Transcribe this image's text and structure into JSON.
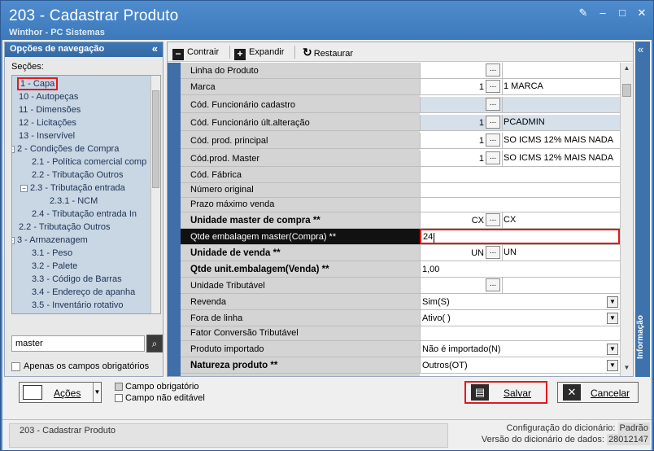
{
  "window": {
    "title": "203 - Cadastrar  Produto",
    "subtitle": "Winthor - PC Sistemas",
    "controls": [
      "✎",
      "–",
      "□",
      "✕"
    ]
  },
  "nav": {
    "header": "Opções de navegação",
    "collapse": "«",
    "sections_label": "Seções:",
    "items": [
      {
        "label": "1 - Capa",
        "level": 0,
        "toggle": ""
      },
      {
        "label": "10 - Autopeças",
        "level": 0,
        "toggle": ""
      },
      {
        "label": "11 - Dimensões",
        "level": 0,
        "toggle": ""
      },
      {
        "label": "12 - Licitações",
        "level": 0,
        "toggle": ""
      },
      {
        "label": "13 - Inservível",
        "level": 0,
        "toggle": ""
      },
      {
        "label": "2 - Condições de Compra",
        "level": 0,
        "toggle": "−"
      },
      {
        "label": "2.1 - Política comercial comp",
        "level": 1,
        "toggle": ""
      },
      {
        "label": "2.2 - Tributação Outros",
        "level": 1,
        "toggle": ""
      },
      {
        "label": "2.3 - Tributação entrada",
        "level": 1,
        "toggle": "−"
      },
      {
        "label": "2.3.1 - NCM",
        "level": 2,
        "toggle": ""
      },
      {
        "label": "2.4 - Tributação entrada In",
        "level": 1,
        "toggle": ""
      },
      {
        "label": "2.2 - Tributação Outros",
        "level": 0,
        "toggle": ""
      },
      {
        "label": "3 - Armazenagem",
        "level": 0,
        "toggle": "−"
      },
      {
        "label": "3.1 - Peso",
        "level": 1,
        "toggle": ""
      },
      {
        "label": "3.2 - Palete",
        "level": 1,
        "toggle": ""
      },
      {
        "label": "3.3 - Código de Barras",
        "level": 1,
        "toggle": ""
      },
      {
        "label": "3.4 - Endereço de apanha",
        "level": 1,
        "toggle": ""
      },
      {
        "label": "3.5 - Inventário rotativo",
        "level": 1,
        "toggle": ""
      }
    ],
    "search_value": "master",
    "only_required_label": "Apenas os campos obrigatórios"
  },
  "toolbar": {
    "contrair": "Contrair",
    "expandir": "Expandir",
    "restaurar": "Restaurar"
  },
  "fields": [
    {
      "label": "Linha do Produto",
      "bold": false,
      "type": "lookup",
      "code": "",
      "desc": "",
      "shade": false
    },
    {
      "label": "Marca",
      "bold": false,
      "type": "lookup",
      "code": "1",
      "desc": "1 MARCA",
      "shade": false
    },
    {
      "label": "Cód. Funcionário cadastro",
      "bold": false,
      "type": "lookup",
      "code": "",
      "desc": "",
      "shade": true
    },
    {
      "label": "Cód. Funcionário últ.alteração",
      "bold": false,
      "type": "lookup",
      "code": "1",
      "desc": "PCADMIN",
      "shade": true
    },
    {
      "label": "Cód. prod. principal",
      "bold": false,
      "type": "lookup",
      "code": "1",
      "desc": "SO ICMS 12% MAIS NADA",
      "shade": false
    },
    {
      "label": "Cód.prod. Master",
      "bold": false,
      "type": "lookup",
      "code": "1",
      "desc": "SO ICMS 12% MAIS NADA",
      "shade": false
    },
    {
      "label": "Cód. Fábrica",
      "bold": false,
      "type": "text",
      "value": ""
    },
    {
      "label": "Número original",
      "bold": false,
      "type": "text",
      "value": ""
    },
    {
      "label": "Prazo máximo venda",
      "bold": false,
      "type": "text",
      "value": ""
    },
    {
      "label": "Unidade master de compra **",
      "bold": true,
      "type": "lookup",
      "code": "CX",
      "desc": "CX",
      "shade": false
    },
    {
      "label": "Qtde embalagem master(Compra) **",
      "bold": false,
      "type": "input",
      "value": "24",
      "selected": true
    },
    {
      "label": "Unidade de venda **",
      "bold": true,
      "type": "lookup",
      "code": "UN",
      "desc": "UN",
      "shade": false
    },
    {
      "label": "Qtde unit.embalagem(Venda) **",
      "bold": true,
      "type": "text",
      "value": "1,00"
    },
    {
      "label": "Unidade Tributável",
      "bold": false,
      "type": "lookup",
      "code": "",
      "desc": "",
      "shade": false
    },
    {
      "label": "Revenda",
      "bold": false,
      "type": "combo",
      "value": "Sim(S)"
    },
    {
      "label": "Fora de linha",
      "bold": false,
      "type": "combo",
      "value": "Ativo( )"
    },
    {
      "label": "Fator Conversão Tributável",
      "bold": false,
      "type": "text",
      "value": ""
    },
    {
      "label": "Produto importado",
      "bold": false,
      "type": "combo",
      "value": "Não é importado(N)"
    },
    {
      "label": "Natureza produto **",
      "bold": true,
      "type": "combo",
      "value": "Outros(OT)"
    }
  ],
  "info_strip": {
    "label": "Informação",
    "collapse": "«"
  },
  "bottom": {
    "acoes": "Ações",
    "legend_required": "Campo obrigatório",
    "legend_not_editable": "Campo não editável",
    "salvar": "Salvar",
    "cancelar": "Cancelar"
  },
  "status": {
    "left": "203 - Cadastrar  Produto",
    "config_label": "Configuração do dicionário:",
    "config_value": "Padrão",
    "version_label": "Versão do dicionário de dados:",
    "version_value": "28012147"
  }
}
